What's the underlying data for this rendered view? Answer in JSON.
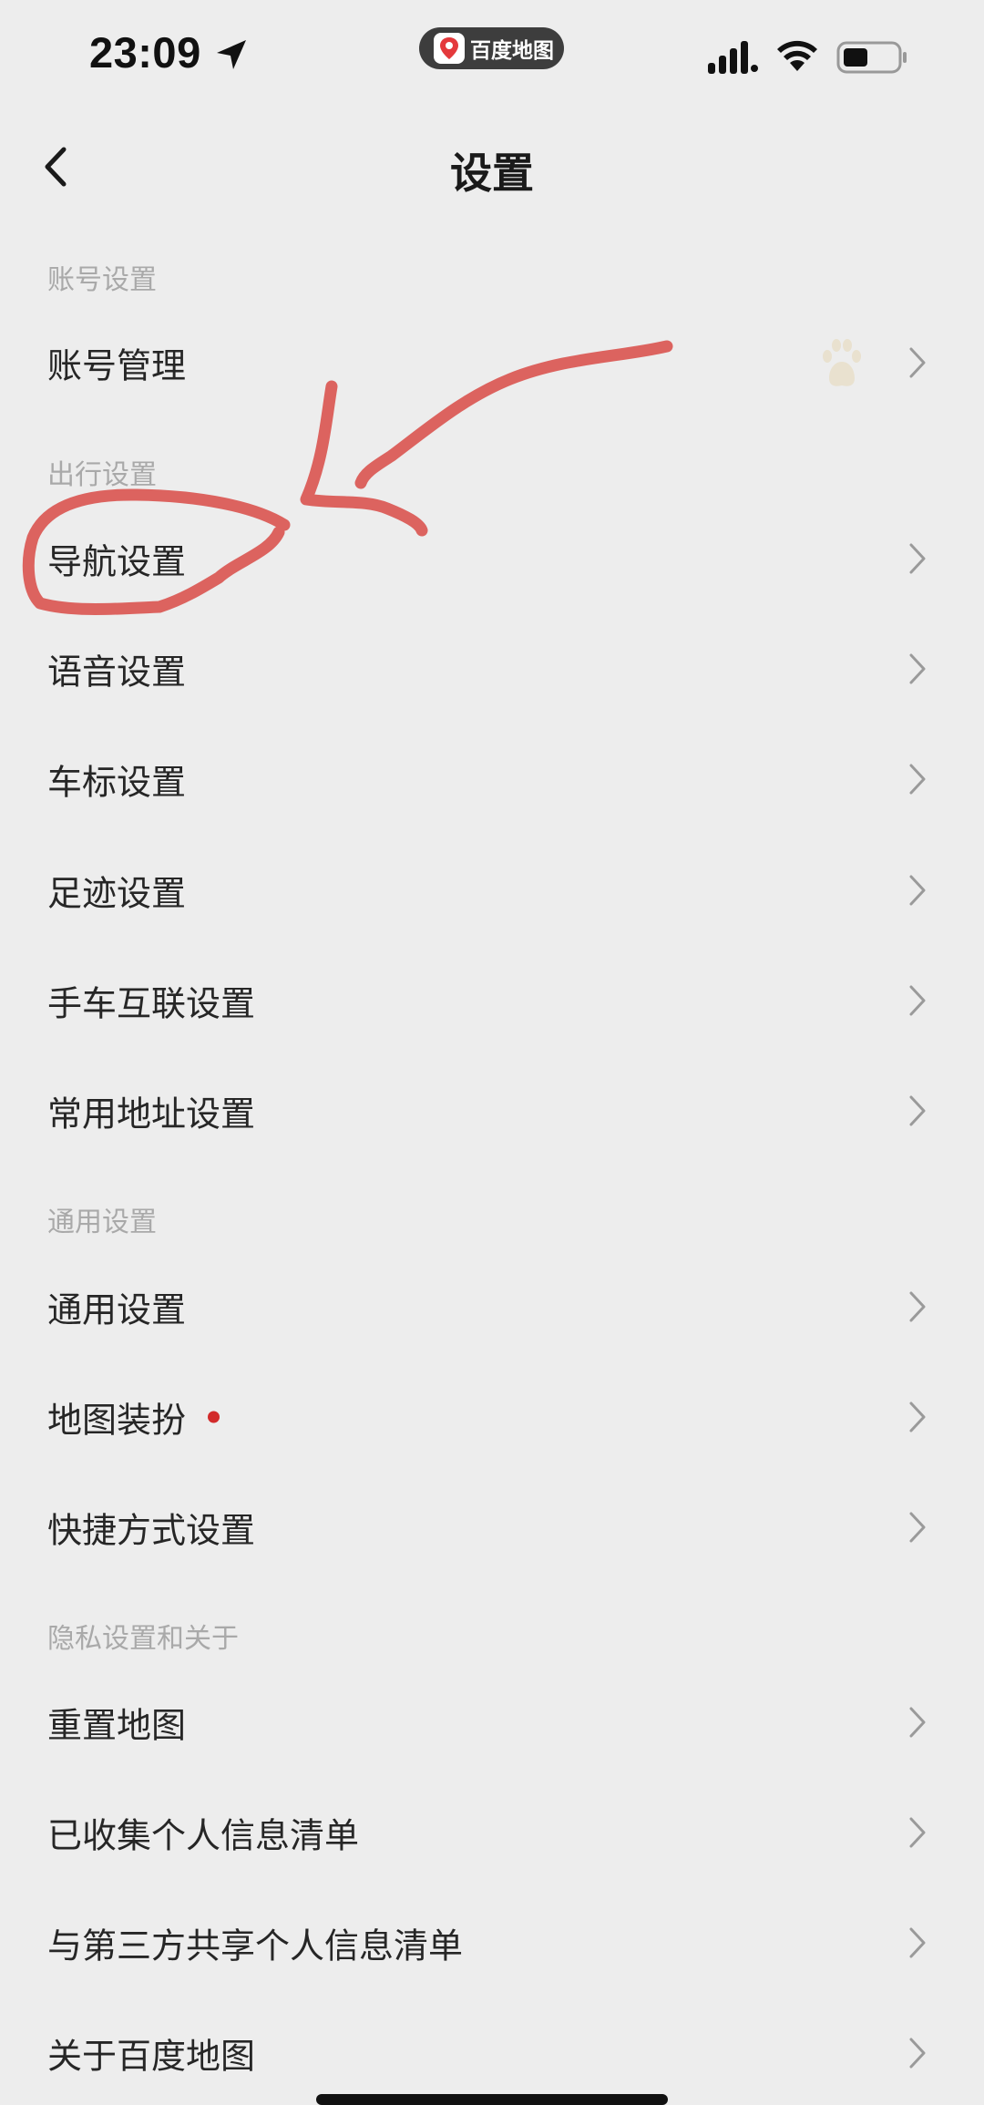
{
  "status_bar": {
    "time": "23:09",
    "app_pill": "百度地图",
    "icons": [
      "location-arrow-icon",
      "cellular-signal-icon",
      "wifi-icon",
      "battery-icon"
    ]
  },
  "nav": {
    "title": "设置",
    "back_icon": "back-chevron-icon"
  },
  "sections": {
    "account": {
      "header": "账号设置",
      "items": [
        "账号管理"
      ]
    },
    "travel": {
      "header": "出行设置",
      "items": [
        "导航设置",
        "语音设置",
        "车标设置",
        "足迹设置",
        "手车互联设置",
        "常用地址设置"
      ]
    },
    "general": {
      "header": "通用设置",
      "items": [
        "通用设置",
        "地图装扮",
        "快捷方式设置"
      ]
    },
    "privacy": {
      "header": "隐私设置和关于",
      "items": [
        "重置地图",
        "已收集个人信息清单",
        "与第三方共享个人信息清单",
        "关于百度地图"
      ]
    }
  },
  "badges": {
    "map_decoration_dot": true,
    "account_avatar_icon": "baidu-paw-icon"
  },
  "colors": {
    "background": "#ededed",
    "annotation": "#d9534f",
    "badge_dot": "#d22b2b",
    "section_header": "#a9a9a9"
  }
}
